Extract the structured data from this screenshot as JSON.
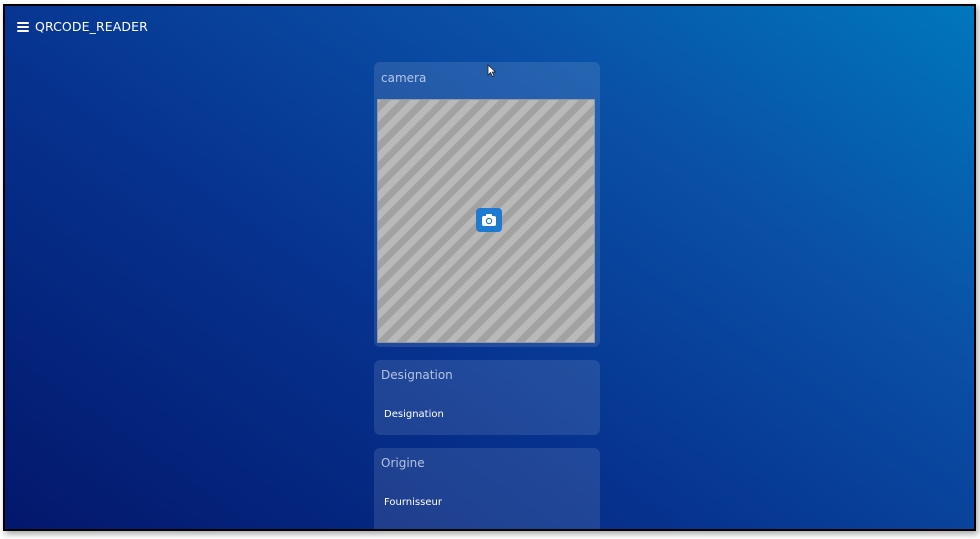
{
  "app": {
    "title": "QRCODE_READER",
    "menu_icon": "hamburger-menu-icon"
  },
  "camera": {
    "label": "camera",
    "button_icon": "camera-icon",
    "button_color": "#1c7ad0"
  },
  "designation": {
    "label": "Designation",
    "value": "Designation"
  },
  "origine": {
    "label": "Origine",
    "value": "Fournisseur"
  },
  "colors": {
    "background_start": "#0077bd",
    "background_end": "#03176c"
  }
}
